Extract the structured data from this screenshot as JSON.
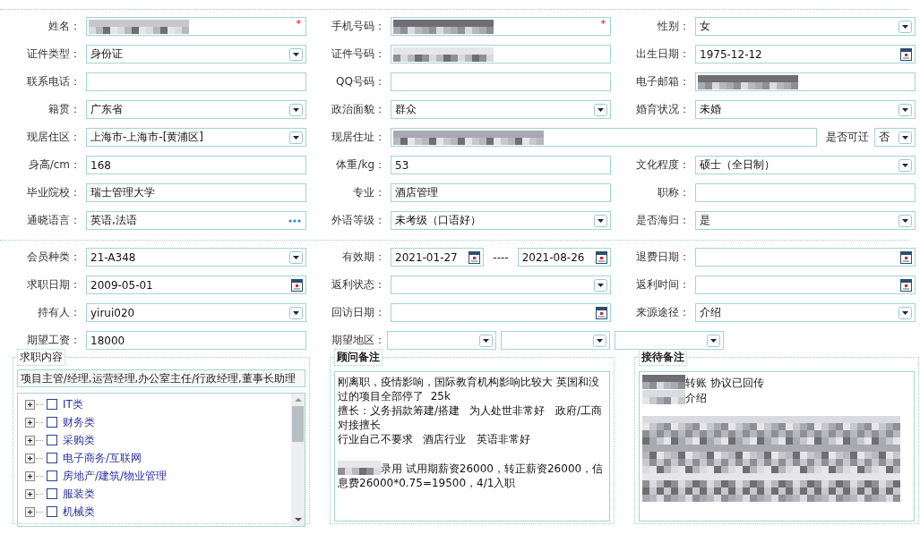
{
  "sections": [
    {
      "fields": [
        {
          "label": "姓名：",
          "kind": "text",
          "redacted": true,
          "required_mark": "*"
        },
        {
          "label": "手机号码：",
          "kind": "text",
          "redacted": true,
          "required_mark": "*"
        },
        {
          "label": "性别：",
          "kind": "select",
          "value": "女"
        },
        {
          "label": "证件类型：",
          "kind": "select",
          "value": "身份证"
        },
        {
          "label": "证件号码：",
          "kind": "text",
          "redacted": true
        },
        {
          "label": "出生日期：",
          "kind": "date",
          "value": "1975-12-12"
        },
        {
          "label": "联系电话：",
          "kind": "text"
        },
        {
          "label": "QQ号码：",
          "kind": "text"
        },
        {
          "label": "电子邮箱：",
          "kind": "text",
          "redacted": true
        },
        {
          "label": "籍贯：",
          "kind": "select",
          "value": "广东省"
        },
        {
          "label": "政治面貌：",
          "kind": "select",
          "value": "群众"
        },
        {
          "label": "婚育状况：",
          "kind": "select",
          "value": "未婚"
        },
        {
          "label": "现居住区：",
          "kind": "select",
          "value": "上海市-上海市-[黄浦区]"
        },
        {
          "label": "现居住址：",
          "kind": "wide",
          "redacted": true,
          "extra": {
            "label": "是否可迁",
            "value": "否"
          }
        },
        {
          "label": "身高/cm：",
          "kind": "text",
          "value": "168"
        },
        {
          "label": "体重/kg：",
          "kind": "text",
          "value": "53"
        },
        {
          "label": "文化程度：",
          "kind": "select",
          "value": "硕士（全日制）"
        },
        {
          "label": "毕业院校：",
          "kind": "text",
          "value": "瑞士管理大学"
        },
        {
          "label": "专业：",
          "kind": "text",
          "value": "酒店管理"
        },
        {
          "label": "职称：",
          "kind": "text"
        },
        {
          "label": "通晓语言：",
          "kind": "lookup",
          "value": "英语,法语"
        },
        {
          "label": "外语等级：",
          "kind": "select",
          "value": "未考级（口语好）"
        },
        {
          "label": "是否海归：",
          "kind": "select",
          "value": "是"
        }
      ]
    },
    {
      "fields": [
        {
          "label": "会员种类：",
          "kind": "select",
          "value": "21-A348"
        },
        {
          "label": "有效期：",
          "kind": "range",
          "values": [
            "2021-01-27",
            "2021-08-26"
          ],
          "separator": "----"
        },
        {
          "label": "退费日期：",
          "kind": "date"
        },
        {
          "label": "求职日期：",
          "kind": "date",
          "value": "2009-05-01"
        },
        {
          "label": "返利状态：",
          "kind": "select"
        },
        {
          "label": "返利时间：",
          "kind": "date"
        },
        {
          "label": "持有人：",
          "kind": "select",
          "value": "yirui020"
        },
        {
          "label": "回访日期：",
          "kind": "date"
        },
        {
          "label": "来源途径：",
          "kind": "select",
          "value": "介绍"
        },
        {
          "label": "期望工资：",
          "kind": "text",
          "value": "18000"
        },
        {
          "label": "期望地区：",
          "kind": "multi",
          "selects": [
            {
              "kind": "select"
            },
            {
              "kind": "select"
            },
            {
              "kind": "select"
            }
          ]
        }
      ]
    }
  ],
  "job_panel": {
    "legend": "求职内容",
    "summary": "项目主管/经理,运营经理,办公室主任/行政经理,董事长助理",
    "tree": [
      {
        "label": "IT类",
        "checked": false,
        "expanded": false
      },
      {
        "label": "财务类",
        "checked": false,
        "expanded": false
      },
      {
        "label": "采购类",
        "checked": false,
        "expanded": false
      },
      {
        "label": "电子商务/互联网",
        "checked": false,
        "expanded": false
      },
      {
        "label": "房地产/建筑/物业管理",
        "checked": false,
        "expanded": false
      },
      {
        "label": "服装类",
        "checked": false,
        "expanded": false
      },
      {
        "label": "机械类",
        "checked": false,
        "expanded": false
      }
    ]
  },
  "notes": [
    {
      "legend": "顾问备注",
      "lines": [
        {
          "kind": "text",
          "text": "刚离职，疫情影响，国际教育机构影响比较大 英国和没过的项目全部停了  25k"
        },
        {
          "kind": "text",
          "text": "擅长：义务捐款筹建/搭建   为人处世非常好   政府/工商对接擅长"
        },
        {
          "kind": "text",
          "text": "行业自己不要求   酒店行业   英语非常好"
        },
        {
          "kind": "blank"
        },
        {
          "kind": "text",
          "redacted": true,
          "text": "录用 试用期薪资26000，转正薪资26000，信息费26000*0.75=19500，4/1入职"
        }
      ]
    },
    {
      "legend": "接待备注",
      "lines": [
        {
          "kind": "text",
          "redacted": true,
          "text": "转账 协议已回传"
        },
        {
          "kind": "text",
          "redacted": true,
          "text": "介绍"
        }
      ],
      "redacted_block": true
    }
  ]
}
